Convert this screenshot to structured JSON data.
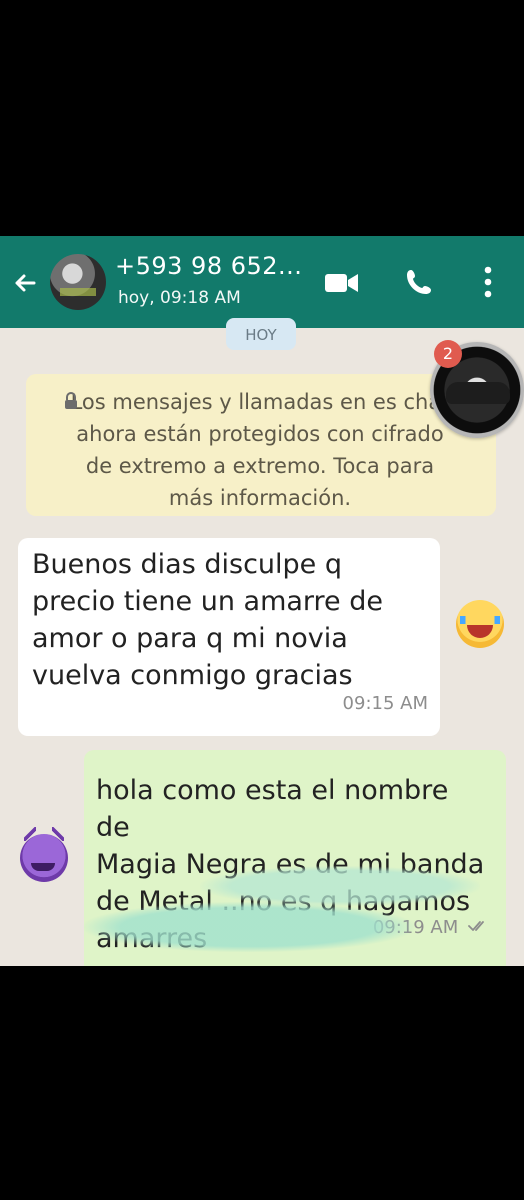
{
  "header": {
    "contact_title": "+593 98 652...",
    "status": "hoy, 09:18 AM",
    "colors": {
      "bar": "#127a6b",
      "chat_bg": "#ebe6df"
    }
  },
  "chat": {
    "date_chip": "HOY",
    "notice": "Los mensajes y llamadas en es chat ahora están protegidos con cifrado de extremo a extremo. Toca para más información.",
    "badge_count": "2",
    "messages": [
      {
        "direction": "incoming",
        "text": "Buenos dias disculpe q\nprecio tiene un amarre de\namor o para q mi novia\nvuelva conmigo gracias",
        "time": "09:15 AM"
      },
      {
        "direction": "outgoing",
        "text": "hola como esta el nombre de\nMagia Negra es de mi banda\nde Metal ..no es q hagamos\namarres",
        "time": "09:19 AM"
      }
    ]
  },
  "icons": [
    "back-arrow-icon",
    "video-icon",
    "call-icon",
    "menu-icon",
    "lock-icon",
    "double-check-icon",
    "laughing-emoji",
    "devil-emoji"
  ]
}
